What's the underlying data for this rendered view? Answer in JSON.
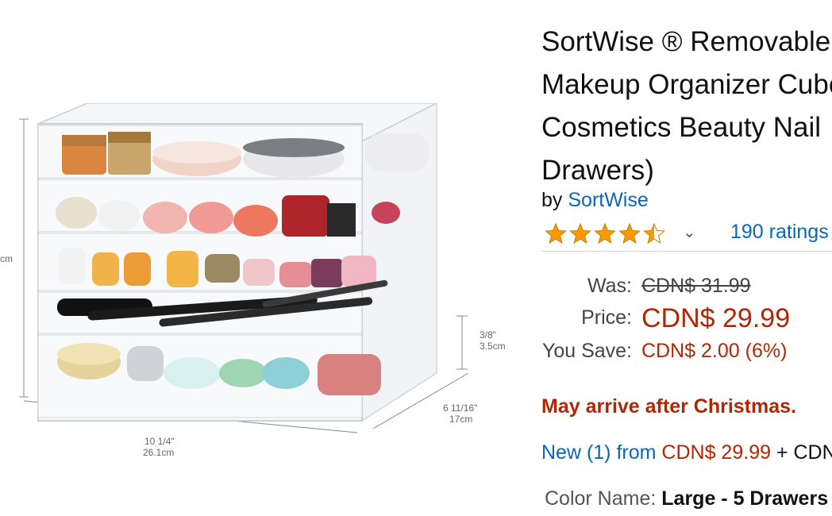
{
  "image": {
    "dim_height_fraction": "3/8\"",
    "dim_height_cm": "3.5cm",
    "dim_width_in": "10 1/4\"",
    "dim_width_cm": "26.1cm",
    "dim_depth_in": "6 11/16\"",
    "dim_depth_cm": "17cm",
    "dim_left_partial": "cm"
  },
  "product": {
    "title_lines": [
      "SortWise ® Removable",
      "Makeup Organizer Cube",
      "Cosmetics Beauty Nail",
      "Drawers)"
    ],
    "by_prefix": "by",
    "brand": "SortWise",
    "rating": 4.5,
    "ratings_count": "190 ratings",
    "star_color": "#ff9900"
  },
  "pricing": {
    "was_label": "Was:",
    "was_value": "CDN$ 31.99",
    "price_label": "Price:",
    "price_value": "CDN$ 29.99",
    "save_label": "You Save:",
    "save_value": "CDN$ 2.00 (6%)"
  },
  "delivery_notice": "May arrive after Christmas.",
  "offers": {
    "prefix": "New (1) from",
    "price": "CDN$ 29.99",
    "suffix": "+ CDN"
  },
  "color": {
    "label": "Color Name:",
    "value": "Large - 5 Drawers"
  },
  "colors": {
    "link": "#0a66b7",
    "price": "#b12704"
  }
}
